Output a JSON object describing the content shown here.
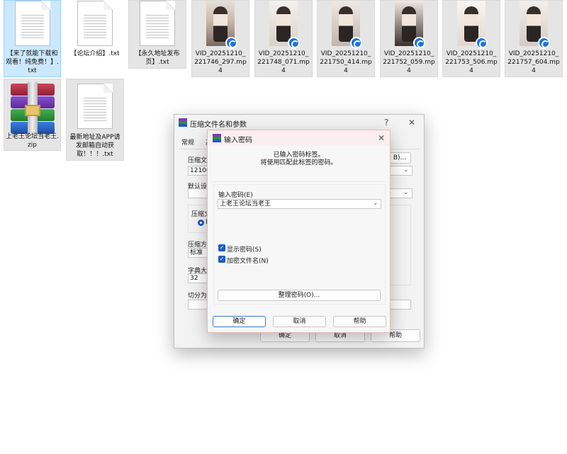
{
  "files": [
    {
      "name": "【来了就能下载和观看！纯免费！】.txt",
      "kind": "txt"
    },
    {
      "name": "【论坛介绍】.txt",
      "kind": "txt"
    },
    {
      "name": "【永久地址发布页】.txt",
      "kind": "txt"
    },
    {
      "name": "VID_20251210_221746_297.mp4",
      "kind": "video"
    },
    {
      "name": "VID_20251210_221748_071.mp4",
      "kind": "video"
    },
    {
      "name": "VID_20251210_221750_414.mp4",
      "kind": "video"
    },
    {
      "name": "VID_20251210_221752_059.mp4",
      "kind": "video"
    },
    {
      "name": "VID_20251210_221753_506.mp4",
      "kind": "video"
    },
    {
      "name": "VID_20251210_221757_604.mp4",
      "kind": "video"
    },
    {
      "name": "上老王论坛当老王.zip",
      "kind": "archive"
    },
    {
      "name": "最新地址及APP请发邮箱自动获取！！！.txt",
      "kind": "txt"
    }
  ],
  "archive_dialog": {
    "title": "压缩文件名和参数",
    "help_glyph": "?",
    "close_glyph": "✕",
    "tab_general": "常规",
    "tab_partial": "高",
    "label_archive_name": "压缩文",
    "archive_name_value": "1210C",
    "browse_partial": "B)...",
    "label_default": "默认设",
    "label_format": "压缩文",
    "radio_partial": "F",
    "label_method": "压缩方",
    "method_value": "标准",
    "label_dict": "字典大",
    "dict_value": "32",
    "label_split": "切分为",
    "ok_label": "确定",
    "cancel_label": "取消",
    "help_label": "帮助"
  },
  "password_dialog": {
    "title": "输入密码",
    "close_glyph": "✕",
    "info_line1": "已输入密码标签。",
    "info_line2": "将使用匹配此标签的密码。",
    "password_label": "输入密码(E)",
    "password_value": "上老王论坛当老王",
    "show_password_label": "显示密码(S)",
    "encrypt_names_label": "加密文件名(N)",
    "organize_button": "整理密码(O)...",
    "ok_label": "确定",
    "cancel_label": "取消",
    "help_label": "帮助"
  }
}
